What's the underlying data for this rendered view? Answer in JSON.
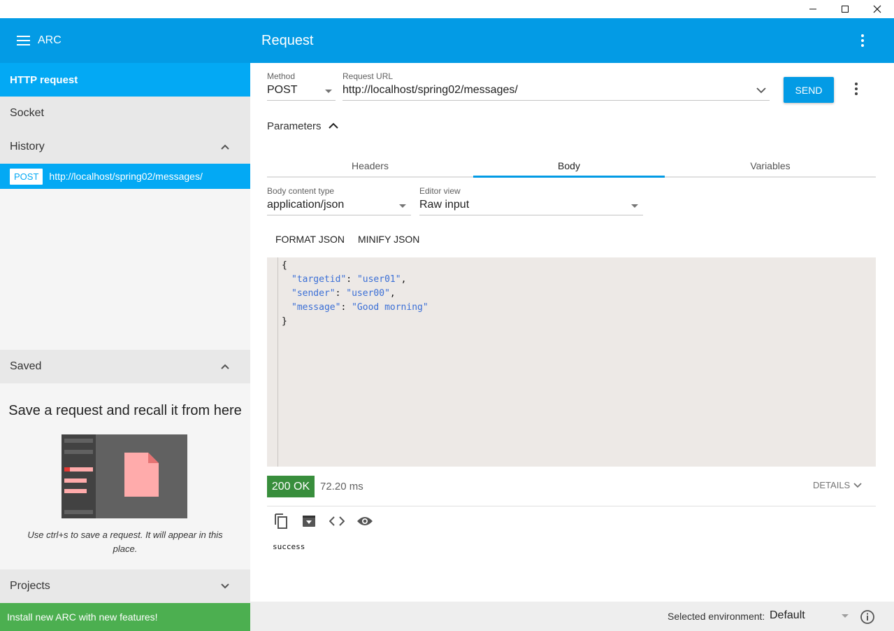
{
  "window": {
    "minimize_glyph": "—",
    "maximize_glyph": "☐",
    "close_glyph": "✕"
  },
  "sidebar": {
    "app_title": "ARC",
    "nav": [
      {
        "label": "HTTP request",
        "active": true
      },
      {
        "label": "Socket",
        "active": false
      }
    ],
    "history": {
      "title": "History",
      "items": [
        {
          "method": "POST",
          "url": "http://localhost/spring02/messages/"
        }
      ]
    },
    "saved": {
      "title": "Saved",
      "empty_title": "Save a request and recall it from here",
      "empty_hint": "Use ctrl+s to save a request. It will appear in this place."
    },
    "projects": {
      "title": "Projects"
    },
    "install_banner": "Install new ARC with new features!"
  },
  "header": {
    "title": "Request"
  },
  "request": {
    "method_label": "Method",
    "method_value": "POST",
    "url_label": "Request URL",
    "url_value": "http://localhost/spring02/messages/",
    "send_label": "SEND",
    "parameters_label": "Parameters",
    "tabs": [
      {
        "label": "Headers",
        "active": false
      },
      {
        "label": "Body",
        "active": true
      },
      {
        "label": "Variables",
        "active": false
      }
    ],
    "body_content_type_label": "Body content type",
    "body_content_type_value": "application/json",
    "editor_view_label": "Editor view",
    "editor_view_value": "Raw input",
    "format_json_label": "FORMAT JSON",
    "minify_json_label": "MINIFY JSON",
    "body_lines": [
      {
        "open": "{"
      },
      {
        "key": "\"targetid\"",
        "value": "\"user01\"",
        "trail": ","
      },
      {
        "key": "\"sender\"",
        "value": "\"user00\"",
        "trail": ","
      },
      {
        "key": "\"message\"",
        "value": "\"Good morning\"",
        "trail": ""
      },
      {
        "close": "}"
      }
    ]
  },
  "response": {
    "status": "200 OK",
    "status_color": "#388e3c",
    "time": "72.20 ms",
    "details_label": "DETAILS",
    "body": "success"
  },
  "footer": {
    "env_label": "Selected environment:",
    "env_value": "Default"
  },
  "colors": {
    "primary": "#039be5",
    "active_item": "#03a9f4",
    "success": "#4caf50"
  }
}
